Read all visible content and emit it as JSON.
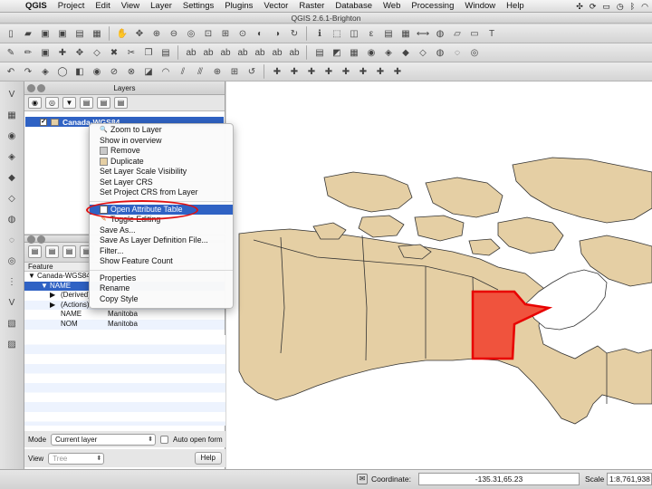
{
  "menubar": {
    "app": "QGIS",
    "items": [
      "Project",
      "Edit",
      "View",
      "Layer",
      "Settings",
      "Plugins",
      "Vector",
      "Raster",
      "Database",
      "Web",
      "Processing",
      "Window",
      "Help"
    ]
  },
  "window": {
    "title": "QGIS 2.6.1-Brighton"
  },
  "layers_panel": {
    "title": "Layers",
    "layer_name": "Canada-WGS84"
  },
  "context_menu": {
    "items": [
      {
        "label": "Zoom to Layer",
        "icon": "zoom-icon"
      },
      {
        "label": "Show in overview",
        "icon": ""
      },
      {
        "label": "Remove",
        "icon": "remove-icon"
      },
      {
        "label": "Duplicate",
        "icon": "duplicate-icon"
      },
      {
        "label": "Set Layer Scale Visibility",
        "icon": ""
      },
      {
        "label": "Set Layer CRS",
        "icon": ""
      },
      {
        "label": "Set Project CRS from Layer",
        "icon": ""
      },
      {
        "label": "Open Attribute Table",
        "icon": "table-icon",
        "highlighted": true
      },
      {
        "label": "Toggle Editing",
        "icon": "pencil-icon"
      },
      {
        "label": "Save As...",
        "icon": ""
      },
      {
        "label": "Save As Layer Definition File...",
        "icon": ""
      },
      {
        "label": "Filter...",
        "icon": ""
      },
      {
        "label": "Show Feature Count",
        "icon": ""
      },
      {
        "label": "Properties",
        "icon": ""
      },
      {
        "label": "Rename",
        "icon": ""
      },
      {
        "label": "Copy Style",
        "icon": ""
      }
    ]
  },
  "identify_panel": {
    "header": "Feature",
    "rows": [
      {
        "key": "Canada-WGS84",
        "value": ""
      },
      {
        "key": "NAME",
        "value": ""
      },
      {
        "key": "(Derived)",
        "value": ""
      },
      {
        "key": "(Actions)",
        "value": ""
      },
      {
        "key": "NAME",
        "value": "Manitoba"
      },
      {
        "key": "NOM",
        "value": "Manitoba"
      }
    ],
    "mode_label": "Mode",
    "mode_value": "Current layer",
    "auto_open_label": "Auto open form",
    "view_label": "View",
    "view_value": "Tree",
    "help_label": "Help"
  },
  "statusbar": {
    "coordinate_label": "Coordinate:",
    "coordinate_value": "-135.31,65.23",
    "scale_label": "Scale",
    "scale_value": "1:8,761,938"
  },
  "colors": {
    "land": "#e5cfa4",
    "selected_feature": "#f0533d",
    "selection_outline": "#e80000",
    "highlight": "#2f62c4"
  }
}
